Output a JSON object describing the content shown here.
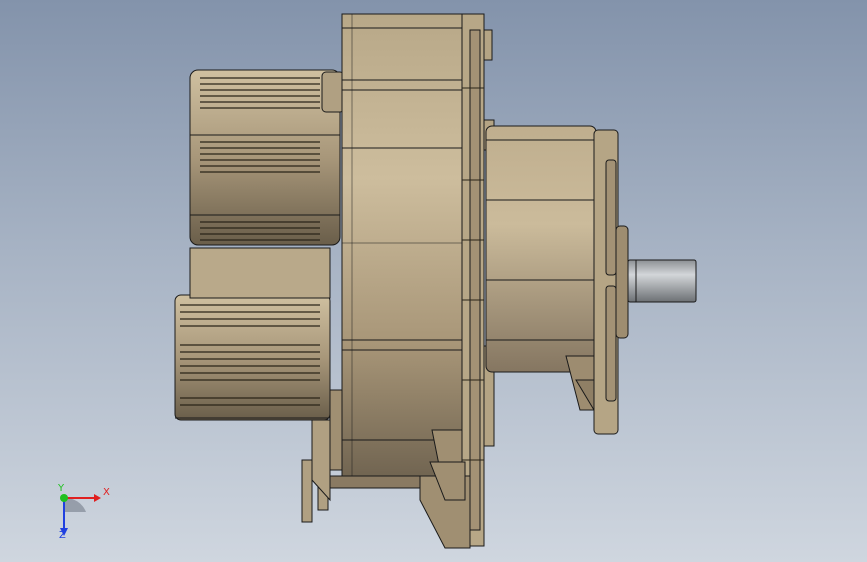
{
  "colors": {
    "background_top": "#8393ab",
    "background_bottom": "#cfd6df",
    "body_light": "#c8b898",
    "body_mid": "#a8977a",
    "body_dark": "#5e5444",
    "edge": "#1a1a1a",
    "shaft": "#aeb2b6",
    "axis_x": "#e02020",
    "axis_y": "#20c020",
    "axis_z": "#2040e0"
  },
  "model": {
    "description_icon": "gear-motor-3d-model",
    "parts": [
      "motor-housing",
      "fin-block-upper",
      "fin-block-lower",
      "flange",
      "gearbox",
      "output-shaft",
      "mounting-feet"
    ]
  },
  "triad": {
    "x_label": "X",
    "y_label": "Y",
    "z_label": "Z"
  }
}
